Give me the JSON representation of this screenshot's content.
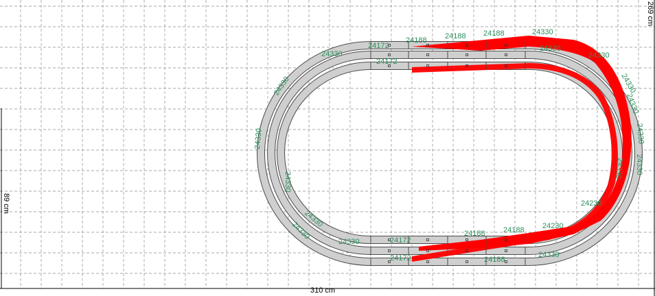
{
  "dimensions": {
    "width_label": "310 cm",
    "height_label": "89 cm",
    "side_label": "269 cm"
  },
  "colors": {
    "track": "#cfcfcf",
    "track_border": "#4a4a4a",
    "grade": "#ff0000",
    "grid": "#8a8a8a",
    "part_label": "#2a8f5a"
  },
  "parts": {
    "top": [
      "24172",
      "24172",
      "24188",
      "24188",
      "24188",
      "24330",
      "24330",
      "24330",
      "24330"
    ],
    "bottom": [
      "24172",
      "24172",
      "24188",
      "24188",
      "24188",
      "24230",
      "24230",
      "24330",
      "24330"
    ],
    "left": [
      "24330",
      "24330",
      "24330",
      "24330",
      "24330"
    ],
    "right": [
      "24330",
      "24330",
      "24330",
      "24330",
      "24330"
    ]
  }
}
